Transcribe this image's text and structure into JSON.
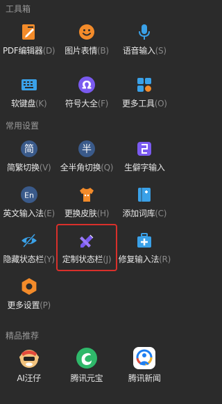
{
  "sections": {
    "toolbox": "工具箱",
    "common_settings": "常用设置",
    "recommended": "精品推荐"
  },
  "toolbox": [
    {
      "label": "PDF编辑器",
      "shortcut": "(D)",
      "icon": "pdf-edit-icon"
    },
    {
      "label": "图片表情",
      "shortcut": "(B)",
      "icon": "smiley-icon"
    },
    {
      "label": "语音输入",
      "shortcut": "(S)",
      "icon": "microphone-icon"
    },
    {
      "label": "软键盘",
      "shortcut": "(K)",
      "icon": "keyboard-icon"
    },
    {
      "label": "符号大全",
      "shortcut": "(F)",
      "icon": "omega-icon"
    },
    {
      "label": "更多工具",
      "shortcut": "(O)",
      "icon": "grid-icon"
    }
  ],
  "settings": [
    {
      "label": "简繁切换",
      "shortcut": "(V)",
      "icon": "simplified-icon",
      "glyph": "简"
    },
    {
      "label": "全半角切换",
      "shortcut": "(Q)",
      "icon": "halfwidth-icon",
      "glyph": "半"
    },
    {
      "label": "生僻字输入",
      "shortcut": "",
      "icon": "rare-char-icon"
    },
    {
      "label": "英文输入法",
      "shortcut": "(E)",
      "icon": "english-icon",
      "glyph": "En"
    },
    {
      "label": "更换皮肤",
      "shortcut": "(H)",
      "icon": "shirt-icon"
    },
    {
      "label": "添加词库",
      "shortcut": "(C)",
      "icon": "book-icon"
    },
    {
      "label": "隐藏状态栏",
      "shortcut": "(Y)",
      "icon": "eye-hide-icon"
    },
    {
      "label": "定制状态栏",
      "shortcut": "(J)",
      "icon": "pencil-ruler-icon"
    },
    {
      "label": "修复输入法",
      "shortcut": "(R)",
      "icon": "medkit-icon"
    },
    {
      "label": "更多设置",
      "shortcut": "(P)",
      "icon": "gear-icon"
    }
  ],
  "recommended": [
    {
      "label": "AI汪仔",
      "icon": "ai-wangzai-icon"
    },
    {
      "label": "腾讯元宝",
      "icon": "yuanbao-icon"
    },
    {
      "label": "腾讯新闻",
      "icon": "tencent-news-icon"
    }
  ],
  "colors": {
    "background": "#2b2b2b",
    "orange": "#f38b2a",
    "blue": "#3aa1e8",
    "purple": "#7a5af0",
    "highlight": "#d9302b"
  }
}
